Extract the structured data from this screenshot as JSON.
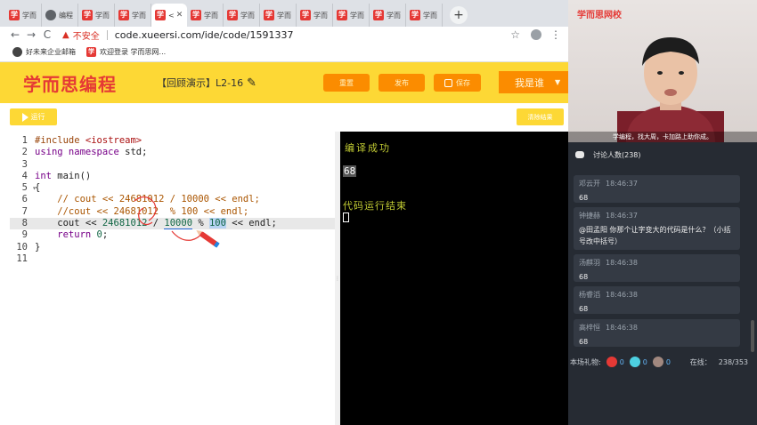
{
  "browser": {
    "tabs": [
      {
        "label": "学而",
        "icon": "xue-icon"
      },
      {
        "label": "编程",
        "icon": "globe-icon"
      },
      {
        "label": "学而",
        "icon": "xue-icon"
      },
      {
        "label": "学而",
        "icon": "xue-icon"
      },
      {
        "label": "<",
        "icon": "xue-icon",
        "active": true
      },
      {
        "label": "学而",
        "icon": "xue-icon"
      },
      {
        "label": "学而",
        "icon": "xue-icon"
      },
      {
        "label": "学而",
        "icon": "xue-icon"
      },
      {
        "label": "学而",
        "icon": "xue-icon"
      },
      {
        "label": "学而",
        "icon": "xue-icon"
      },
      {
        "label": "学而",
        "icon": "xue-icon"
      },
      {
        "label": "学而",
        "icon": "xue-icon"
      }
    ],
    "active_tab_close": "✕",
    "new_tab": "+",
    "security_label": "不安全",
    "url": "code.xueersi.com/ide/code/1591337",
    "bookmarks": [
      "好未来企业邮箱",
      "欢迎登录 学而思网..."
    ]
  },
  "ide": {
    "logo": "学而思编程",
    "project_title": "【回顾演示】L2-16",
    "buttons": {
      "reset": "重置",
      "publish": "发布",
      "save": "保存",
      "user": "我是谁",
      "run": "运行",
      "clear": "清除结果"
    },
    "code_lines": [
      {
        "n": "1"
      },
      {
        "n": "2"
      },
      {
        "n": "3"
      },
      {
        "n": "4"
      },
      {
        "n": "5",
        "fold": "▾"
      },
      {
        "n": "6"
      },
      {
        "n": "7"
      },
      {
        "n": "8"
      },
      {
        "n": "9"
      },
      {
        "n": "10"
      },
      {
        "n": "11"
      }
    ],
    "tokens": {
      "l1a": "#include ",
      "l1b": "<iostream>",
      "l2a": "using namespace",
      "l2b": " std;",
      "l4a": "int",
      "l4b": " main()",
      "l5": "{",
      "l6": "    // cout << 24681012 / 10000 << endl;",
      "l7": "    //cout << 24681012  % 100 << endl;",
      "l8a": "    cout << ",
      "l8b": "24681012",
      "l8c": " / ",
      "l8d": "10000",
      "l8e": " % ",
      "l8f": "100",
      "l8g": " << endl;",
      "l9a": "    return ",
      "l9b": "0",
      "l9c": ";",
      "l10": "}"
    },
    "console": {
      "success": "编译成功",
      "output": "68",
      "end": "代码运行结束"
    }
  },
  "stream": {
    "brand": "学而思网校",
    "subtitle": "学编程，找大周，卡加路上助你成。",
    "discussion_label": "讨论人数",
    "discussion_count": "(238)",
    "messages": [
      {
        "user": "邓云开",
        "time": "18:46:37",
        "text": "68"
      },
      {
        "user": "钟捷赫",
        "time": "18:46:37",
        "text": "@田孟阳 你那个让字变大的代码是什么？（小括号改中括号）"
      },
      {
        "user": "汤麒羽",
        "time": "18:46:38",
        "text": "68"
      },
      {
        "user": "杨睿滔",
        "time": "18:46:38",
        "text": "68"
      },
      {
        "user": "高梓恒",
        "time": "18:46:38",
        "text": "68"
      }
    ],
    "gifts_label": "本场礼物:",
    "gift_counts": [
      "0",
      "0",
      "0"
    ],
    "online_label": "在线：",
    "online_value": "238/353"
  }
}
